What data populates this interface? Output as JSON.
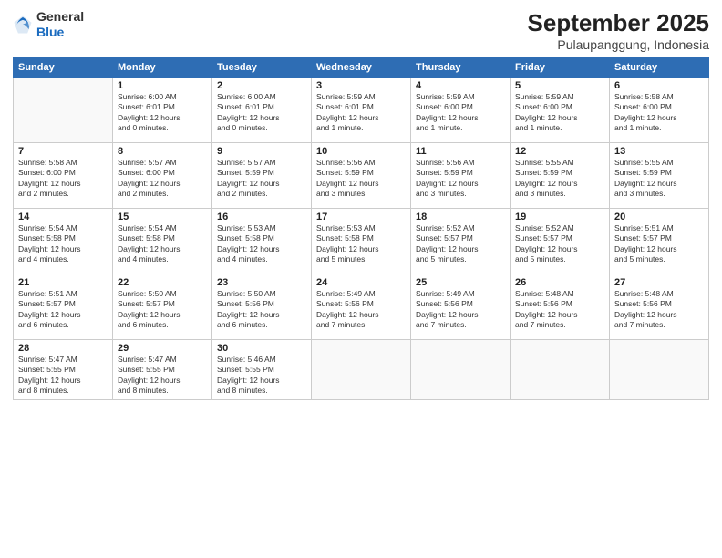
{
  "logo": {
    "general": "General",
    "blue": "Blue"
  },
  "title": "September 2025",
  "location": "Pulaupanggung, Indonesia",
  "days_header": [
    "Sunday",
    "Monday",
    "Tuesday",
    "Wednesday",
    "Thursday",
    "Friday",
    "Saturday"
  ],
  "weeks": [
    [
      {
        "day": "",
        "info": ""
      },
      {
        "day": "1",
        "info": "Sunrise: 6:00 AM\nSunset: 6:01 PM\nDaylight: 12 hours\nand 0 minutes."
      },
      {
        "day": "2",
        "info": "Sunrise: 6:00 AM\nSunset: 6:01 PM\nDaylight: 12 hours\nand 0 minutes."
      },
      {
        "day": "3",
        "info": "Sunrise: 5:59 AM\nSunset: 6:01 PM\nDaylight: 12 hours\nand 1 minute."
      },
      {
        "day": "4",
        "info": "Sunrise: 5:59 AM\nSunset: 6:00 PM\nDaylight: 12 hours\nand 1 minute."
      },
      {
        "day": "5",
        "info": "Sunrise: 5:59 AM\nSunset: 6:00 PM\nDaylight: 12 hours\nand 1 minute."
      },
      {
        "day": "6",
        "info": "Sunrise: 5:58 AM\nSunset: 6:00 PM\nDaylight: 12 hours\nand 1 minute."
      }
    ],
    [
      {
        "day": "7",
        "info": "Sunrise: 5:58 AM\nSunset: 6:00 PM\nDaylight: 12 hours\nand 2 minutes."
      },
      {
        "day": "8",
        "info": "Sunrise: 5:57 AM\nSunset: 6:00 PM\nDaylight: 12 hours\nand 2 minutes."
      },
      {
        "day": "9",
        "info": "Sunrise: 5:57 AM\nSunset: 5:59 PM\nDaylight: 12 hours\nand 2 minutes."
      },
      {
        "day": "10",
        "info": "Sunrise: 5:56 AM\nSunset: 5:59 PM\nDaylight: 12 hours\nand 3 minutes."
      },
      {
        "day": "11",
        "info": "Sunrise: 5:56 AM\nSunset: 5:59 PM\nDaylight: 12 hours\nand 3 minutes."
      },
      {
        "day": "12",
        "info": "Sunrise: 5:55 AM\nSunset: 5:59 PM\nDaylight: 12 hours\nand 3 minutes."
      },
      {
        "day": "13",
        "info": "Sunrise: 5:55 AM\nSunset: 5:59 PM\nDaylight: 12 hours\nand 3 minutes."
      }
    ],
    [
      {
        "day": "14",
        "info": "Sunrise: 5:54 AM\nSunset: 5:58 PM\nDaylight: 12 hours\nand 4 minutes."
      },
      {
        "day": "15",
        "info": "Sunrise: 5:54 AM\nSunset: 5:58 PM\nDaylight: 12 hours\nand 4 minutes."
      },
      {
        "day": "16",
        "info": "Sunrise: 5:53 AM\nSunset: 5:58 PM\nDaylight: 12 hours\nand 4 minutes."
      },
      {
        "day": "17",
        "info": "Sunrise: 5:53 AM\nSunset: 5:58 PM\nDaylight: 12 hours\nand 5 minutes."
      },
      {
        "day": "18",
        "info": "Sunrise: 5:52 AM\nSunset: 5:57 PM\nDaylight: 12 hours\nand 5 minutes."
      },
      {
        "day": "19",
        "info": "Sunrise: 5:52 AM\nSunset: 5:57 PM\nDaylight: 12 hours\nand 5 minutes."
      },
      {
        "day": "20",
        "info": "Sunrise: 5:51 AM\nSunset: 5:57 PM\nDaylight: 12 hours\nand 5 minutes."
      }
    ],
    [
      {
        "day": "21",
        "info": "Sunrise: 5:51 AM\nSunset: 5:57 PM\nDaylight: 12 hours\nand 6 minutes."
      },
      {
        "day": "22",
        "info": "Sunrise: 5:50 AM\nSunset: 5:57 PM\nDaylight: 12 hours\nand 6 minutes."
      },
      {
        "day": "23",
        "info": "Sunrise: 5:50 AM\nSunset: 5:56 PM\nDaylight: 12 hours\nand 6 minutes."
      },
      {
        "day": "24",
        "info": "Sunrise: 5:49 AM\nSunset: 5:56 PM\nDaylight: 12 hours\nand 7 minutes."
      },
      {
        "day": "25",
        "info": "Sunrise: 5:49 AM\nSunset: 5:56 PM\nDaylight: 12 hours\nand 7 minutes."
      },
      {
        "day": "26",
        "info": "Sunrise: 5:48 AM\nSunset: 5:56 PM\nDaylight: 12 hours\nand 7 minutes."
      },
      {
        "day": "27",
        "info": "Sunrise: 5:48 AM\nSunset: 5:56 PM\nDaylight: 12 hours\nand 7 minutes."
      }
    ],
    [
      {
        "day": "28",
        "info": "Sunrise: 5:47 AM\nSunset: 5:55 PM\nDaylight: 12 hours\nand 8 minutes."
      },
      {
        "day": "29",
        "info": "Sunrise: 5:47 AM\nSunset: 5:55 PM\nDaylight: 12 hours\nand 8 minutes."
      },
      {
        "day": "30",
        "info": "Sunrise: 5:46 AM\nSunset: 5:55 PM\nDaylight: 12 hours\nand 8 minutes."
      },
      {
        "day": "",
        "info": ""
      },
      {
        "day": "",
        "info": ""
      },
      {
        "day": "",
        "info": ""
      },
      {
        "day": "",
        "info": ""
      }
    ]
  ]
}
